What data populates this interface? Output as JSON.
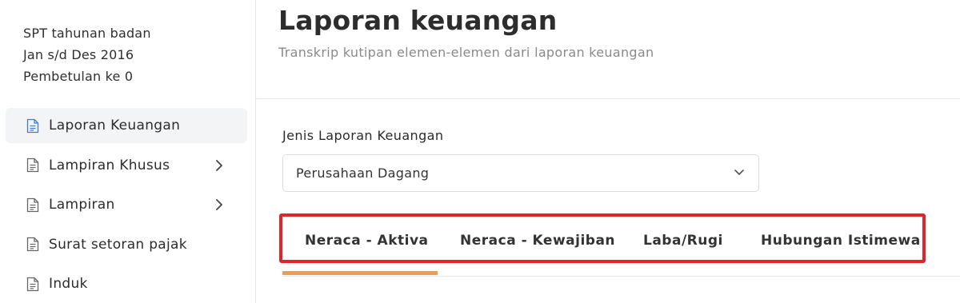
{
  "spt": {
    "line1": "SPT tahunan badan",
    "line2": "Jan s/d Des 2016",
    "line3": "Pembetulan ke 0"
  },
  "sidebar": {
    "items": [
      {
        "label": "Laporan Keuangan",
        "icon": "document-icon",
        "active": true,
        "has_chevron": false
      },
      {
        "label": "Lampiran Khusus",
        "icon": "document-icon",
        "active": false,
        "has_chevron": true
      },
      {
        "label": "Lampiran",
        "icon": "document-icon",
        "active": false,
        "has_chevron": true
      },
      {
        "label": "Surat setoran pajak",
        "icon": "document-icon",
        "active": false,
        "has_chevron": false
      },
      {
        "label": "Induk",
        "icon": "document-icon",
        "active": false,
        "has_chevron": false
      }
    ]
  },
  "header": {
    "title": "Laporan keuangan",
    "subtitle": "Transkrip kutipan elemen-elemen dari laporan keuangan"
  },
  "form": {
    "jenis_label": "Jenis Laporan Keuangan",
    "jenis_value": "Perusahaan Dagang"
  },
  "tabs": [
    {
      "label": "Neraca - Aktiva",
      "active": true
    },
    {
      "label": "Neraca - Kewajiban",
      "active": false
    },
    {
      "label": "Laba/Rugi",
      "active": false
    },
    {
      "label": "Hubungan Istimewa",
      "active": false
    }
  ],
  "colors": {
    "highlight_box": "#e0242e",
    "active_tab_underline": "#f39a4f",
    "active_nav_bg": "#f3f4f6",
    "active_icon": "#3b7ddd"
  }
}
